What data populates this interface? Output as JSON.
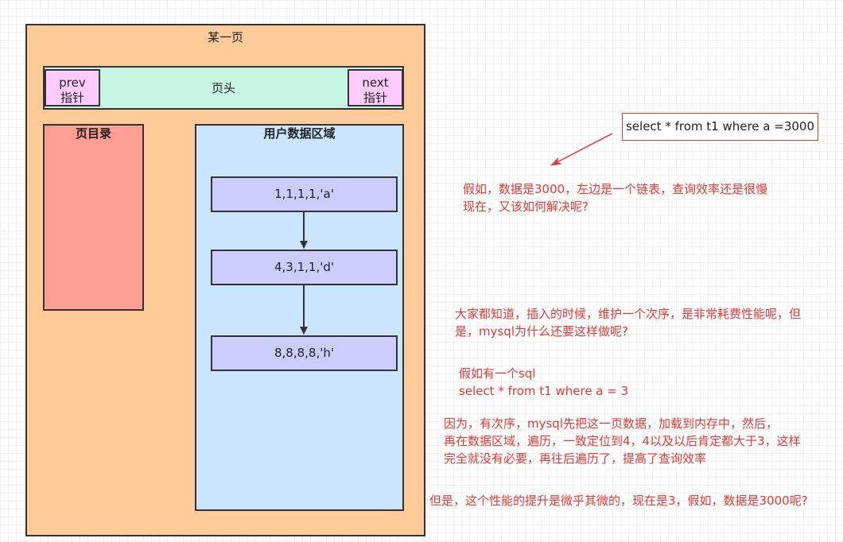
{
  "page": {
    "title": "某一页",
    "header": "页头",
    "prev_pointer": [
      "prev",
      "指针"
    ],
    "next_pointer": [
      "next",
      "指针"
    ],
    "directory_label": "页目录",
    "data_area_label": "用户数据区域",
    "records": [
      "1,1,1,1,'a'",
      "4,3,1,1,'d'",
      "8,8,8,8,'h'"
    ]
  },
  "query_box": "select * from t1 where a =3000",
  "notes": {
    "note1": [
      "假如，数据是3000，左边是一个链表，查询效率还是很慢",
      "现在，又该如何解决呢?"
    ],
    "note2": [
      "大家都知道，插入的时候，维护一个次序，是非常耗费性能呢，但",
      "是，mysql为什么还要这样做呢?"
    ],
    "note3": [
      "假如有一个sql",
      "select * from t1 where a = 3"
    ],
    "note4": [
      "因为，有次序，mysql先把这一页数据，加载到内存中，然后，",
      "再在数据区域，遍历，一致定位到4，4以及以后肯定都大于3，这样",
      "完全就没有必要，再往后遍历了，提高了查询效率"
    ],
    "note5": [
      "但是，这个性能的提升是微乎其微的，现在是3，假如，数据是3000呢?"
    ]
  },
  "colors": {
    "page_fill": "#ffcc99",
    "header_fill": "#c8f5e1",
    "pointer_fill": "#ffccff",
    "directory_fill": "#ff9e94",
    "data_area_fill": "#cce5ff",
    "record_fill": "#ccccff",
    "annotation_red": "#e53935"
  }
}
